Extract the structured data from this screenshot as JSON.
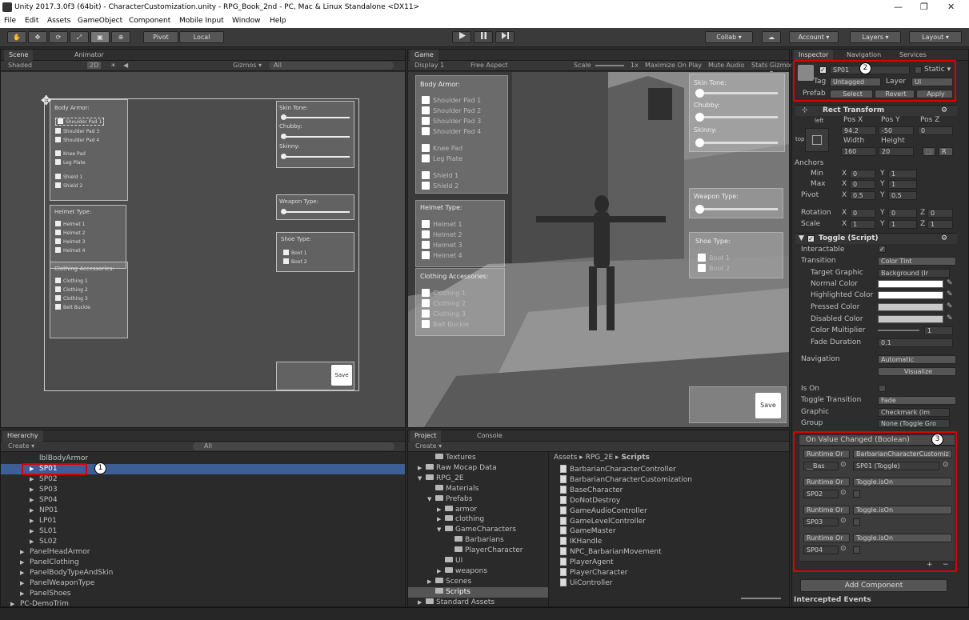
{
  "window": {
    "title": "Unity 2017.3.0f3 (64bit) - CharacterCustomization.unity - RPG_Book_2nd - PC, Mac & Linux Standalone <DX11>",
    "min": "—",
    "max": "❐",
    "close": "✕"
  },
  "menu": [
    "File",
    "Edit",
    "Assets",
    "GameObject",
    "Component",
    "Mobile Input",
    "Window",
    "Help"
  ],
  "toolbar": {
    "pivot": "Pivot",
    "local": "Local",
    "collab": "Collab ▾",
    "account": "Account ▾",
    "layers": "Layers ▾",
    "layout": "Layout ▾",
    "tools": [
      "✋",
      "✥",
      "⟳",
      "⤢",
      "▣",
      "⊕"
    ]
  },
  "scene": {
    "tab_scene": "Scene",
    "tab_animator": "Animator",
    "shaded": "Shaded",
    "mode2d": "2D",
    "gizmos": "Gizmos ▾",
    "search": "All",
    "body_armor": {
      "title": "Body Armor:",
      "items": [
        "Shoulder Pad 1",
        "Shoulder Pad 3",
        "Shoulder Pad 4",
        "Knee Pad",
        "Leg Plate",
        "Shield 1",
        "Shield 2"
      ]
    },
    "helmet": {
      "title": "Helmet Type:",
      "items": [
        "Helmet 1",
        "Helmet 2",
        "Helmet 3",
        "Helmet 4"
      ]
    },
    "clothing": {
      "title": "Clothing Accessories:",
      "items": [
        "Clothing 1",
        "Clothing 2",
        "Clothing 3",
        "Belt Buckle"
      ]
    },
    "skin": {
      "title": "Skin Tone:",
      "chubby": "Chubby:",
      "skinny": "Skinny:"
    },
    "weapon": {
      "title": "Weapon Type:"
    },
    "shoe": {
      "title": "Shoe Type:",
      "items": [
        "Boot 1",
        "Boot 2"
      ]
    },
    "save": "Save"
  },
  "game": {
    "tab": "Game",
    "display": "Display 1",
    "aspect": "Free Aspect",
    "scale_label": "Scale",
    "scale": "1x",
    "maximize": "Maximize On Play",
    "mute": "Mute Audio",
    "stats": "Stats",
    "gizmos": "Gizmos ▾",
    "body_armor": {
      "title": "Body Armor:",
      "items": [
        "Shoulder Pad 1",
        "Shoulder Pad 2",
        "Shoulder Pad 3",
        "Shoulder Pad 4",
        "Knee Pad",
        "Leg Plate",
        "Shield 1",
        "Shield 2"
      ]
    },
    "helmet": {
      "title": "Helmet Type:",
      "items": [
        "Helmet 1",
        "Helmet 2",
        "Helmet 3",
        "Helmet 4"
      ]
    },
    "clothing": {
      "title": "Clothing Accessories:",
      "items": [
        "Clothing 1",
        "Clothing 2",
        "Clothing 3",
        "Belt Buckle"
      ]
    },
    "skin": {
      "title": "Skin Tone:",
      "chubby": "Chubby:",
      "skinny": "Skinny:"
    },
    "weapon": {
      "title": "Weapon Type:"
    },
    "shoe": {
      "title": "Shoe Type:",
      "items": [
        "Boot 1",
        "Boot 2"
      ]
    },
    "save": "Save"
  },
  "hierarchy": {
    "tab": "Hierarchy",
    "create": "Create ▾",
    "search": "All",
    "rows": [
      {
        "t": "lblBodyArmor",
        "d": 3,
        "a": false
      },
      {
        "t": "SP01",
        "d": 3,
        "a": true,
        "sel": true
      },
      {
        "t": "SP02",
        "d": 3,
        "a": true
      },
      {
        "t": "SP03",
        "d": 3,
        "a": true
      },
      {
        "t": "SP04",
        "d": 3,
        "a": true
      },
      {
        "t": "NP01",
        "d": 3,
        "a": true
      },
      {
        "t": "LP01",
        "d": 3,
        "a": true
      },
      {
        "t": "SL01",
        "d": 3,
        "a": true
      },
      {
        "t": "SL02",
        "d": 3,
        "a": true
      },
      {
        "t": "PanelHeadArmor",
        "d": 2,
        "a": true
      },
      {
        "t": "PanelClothing",
        "d": 2,
        "a": true
      },
      {
        "t": "PanelBodyTypeAndSkin",
        "d": 2,
        "a": true
      },
      {
        "t": "PanelWeaponType",
        "d": 2,
        "a": true
      },
      {
        "t": "PanelShoes",
        "d": 2,
        "a": true
      },
      {
        "t": "PC-DemoTrim",
        "d": 1,
        "a": true
      }
    ]
  },
  "project": {
    "tab_project": "Project",
    "tab_console": "Console",
    "create": "Create ▾",
    "tree": [
      {
        "t": "Textures",
        "d": 2,
        "a": ""
      },
      {
        "t": "Raw Mocap Data",
        "d": 1,
        "a": "▶"
      },
      {
        "t": "RPG_2E",
        "d": 1,
        "a": "▼"
      },
      {
        "t": "Materials",
        "d": 2,
        "a": ""
      },
      {
        "t": "Prefabs",
        "d": 2,
        "a": "▼"
      },
      {
        "t": "armor",
        "d": 3,
        "a": "▶"
      },
      {
        "t": "clothing",
        "d": 3,
        "a": "▶"
      },
      {
        "t": "GameCharacters",
        "d": 3,
        "a": "▼"
      },
      {
        "t": "Barbarians",
        "d": 4,
        "a": ""
      },
      {
        "t": "PlayerCharacter",
        "d": 4,
        "a": ""
      },
      {
        "t": "UI",
        "d": 3,
        "a": ""
      },
      {
        "t": "weapons",
        "d": 3,
        "a": "▶"
      },
      {
        "t": "Scenes",
        "d": 2,
        "a": "▶"
      },
      {
        "t": "Scripts",
        "d": 2,
        "a": "",
        "sel": true
      },
      {
        "t": "Standard Assets",
        "d": 1,
        "a": "▶"
      }
    ],
    "breadcrumb": {
      "a": "Assets",
      "b": "RPG_2E",
      "c": "Scripts",
      "sep": "▸"
    },
    "files": [
      "BarbarianCharacterController",
      "BarbarianCharacterCustomization",
      "BaseCharacter",
      "DoNotDestroy",
      "GameAudioController",
      "GameLevelController",
      "GameMaster",
      "IKHandle",
      "NPC_BarbarianMovement",
      "PlayerAgent",
      "PlayerCharacter",
      "UiController"
    ]
  },
  "inspector": {
    "tab_inspector": "Inspector",
    "tab_navigation": "Navigation",
    "tab_services": "Services",
    "name": "SP01",
    "static": "Static ▾",
    "tag_label": "Tag",
    "tag": "Untagged",
    "layer_label": "Layer",
    "layer": "UI",
    "prefab": "Prefab",
    "select": "Select",
    "revert": "Revert",
    "apply": "Apply",
    "rect": {
      "title": "Rect Transform",
      "left": "left",
      "pos_x_l": "Pos X",
      "pos_y_l": "Pos Y",
      "pos_z_l": "Pos Z",
      "pos_x": "94.2",
      "pos_y": "-50",
      "pos_z": "0",
      "width_l": "Width",
      "height_l": "Height",
      "width": "160",
      "height": "20",
      "anchors": "Anchors",
      "min": "Min",
      "max": "Max",
      "pivot": "Pivot",
      "min_x": "0",
      "min_y": "1",
      "max_x": "0",
      "max_y": "1",
      "pivot_x": "0.5",
      "pivot_y": "0.5",
      "rotation": "Rotation",
      "scale": "Scale",
      "rot_x": "0",
      "rot_y": "0",
      "rot_z": "0",
      "sc_x": "1",
      "sc_y": "1",
      "sc_z": "1",
      "x": "X",
      "y": "Y",
      "z": "Z",
      "top": "top",
      "r": "R"
    },
    "toggle": {
      "title": "Toggle (Script)",
      "interactable": "Interactable",
      "transition": "Transition",
      "transition_v": "Color Tint",
      "target": "Target Graphic",
      "target_v": "Background (Ir",
      "normal": "Normal Color",
      "highlighted": "Highlighted Color",
      "pressed": "Pressed Color",
      "disabled": "Disabled Color",
      "multiplier": "Color Multiplier",
      "multiplier_v": "1",
      "fade": "Fade Duration",
      "fade_v": "0.1",
      "navigation": "Navigation",
      "navigation_v": "Automatic",
      "visualize": "Visualize",
      "is_on": "Is On",
      "toggle_transition": "Toggle Transition",
      "toggle_transition_v": "Fade",
      "graphic": "Graphic",
      "graphic_v": "Checkmark (Im",
      "group": "Group",
      "group_v": "None (Toggle Gro"
    },
    "events": {
      "title": "On Value Changed (Boolean)",
      "rows": [
        {
          "mode": "Runtime Or",
          "fn": "BarbarianCharacterCustomiz",
          "obj": "__Bas",
          "arg": "SP01 (Toggle)"
        },
        {
          "mode": "Runtime Or",
          "fn": "Toggle.isOn",
          "obj": "SP02",
          "arg": ""
        },
        {
          "mode": "Runtime Or",
          "fn": "Toggle.isOn",
          "obj": "SP03",
          "arg": ""
        },
        {
          "mode": "Runtime Or",
          "fn": "Toggle.isOn",
          "obj": "SP04",
          "arg": ""
        }
      ],
      "plus": "+",
      "minus": "−"
    },
    "add_component": "Add Component",
    "intercepted": "Intercepted Events"
  },
  "badges": [
    "1",
    "2",
    "3"
  ],
  "colors": {
    "highlight": "#d00000",
    "selection": "#3e5f96"
  }
}
